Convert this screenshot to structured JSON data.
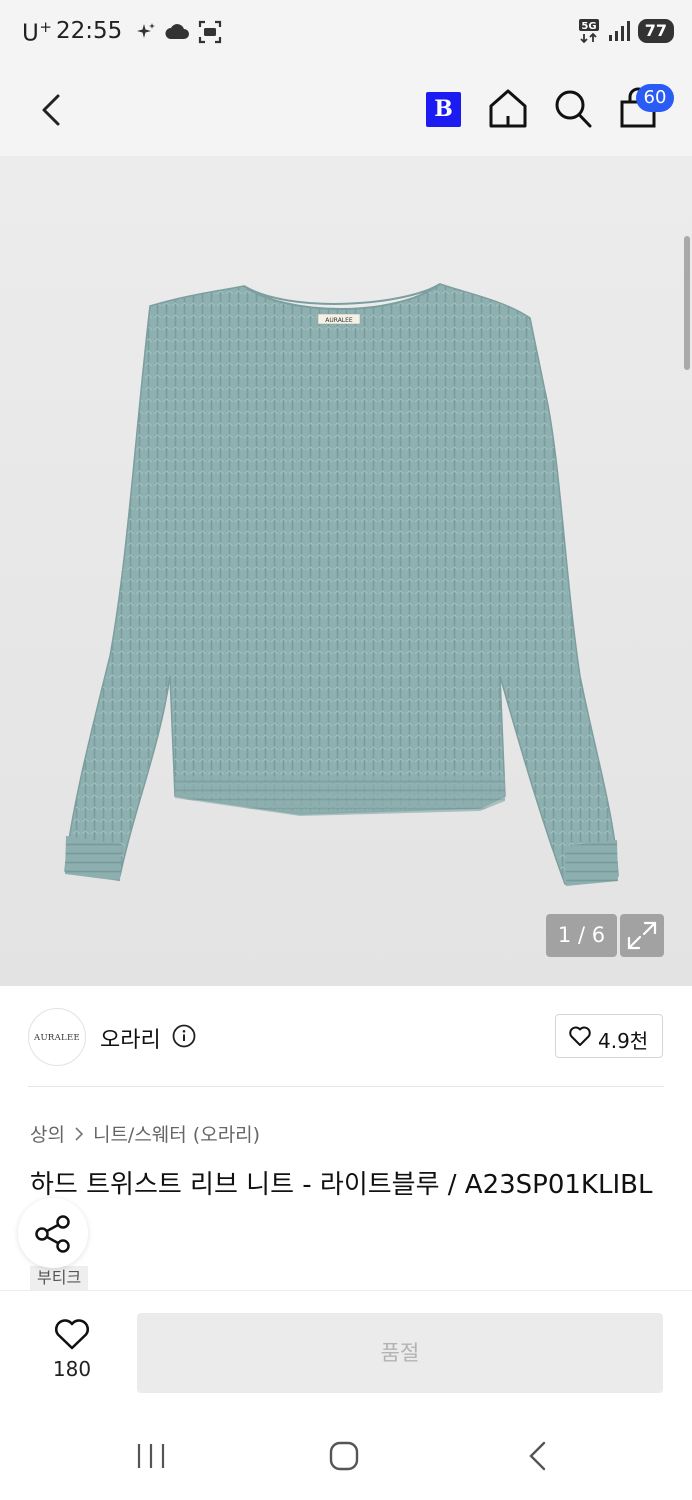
{
  "status_bar": {
    "carrier": "U",
    "carrier_sup": "+",
    "time": "22:55",
    "network": "5G",
    "battery": "77"
  },
  "nav": {
    "brand_logo_letter": "B",
    "cart_count": "60"
  },
  "gallery": {
    "counter": "1 / 6",
    "label_text": "AURALEE",
    "sweater_color": "#8fb0b0"
  },
  "brand": {
    "logo_text": "AURALEE",
    "name": "오라리",
    "likes": "4.9천"
  },
  "breadcrumb": {
    "items": [
      "상의",
      "니트/스웨터 (오라리)"
    ]
  },
  "product": {
    "title": "하드 트위스트 리브 니트 - 라이트블루 / A23SP01KLIBL",
    "tag": "부티크"
  },
  "action_bar": {
    "wish_count": "180",
    "soldout_label": "품절"
  },
  "icons": {
    "back": "chevron-left-icon",
    "home": "home-icon",
    "search": "search-icon",
    "cart": "shopping-bag-icon",
    "expand": "expand-icon",
    "info": "info-icon",
    "heart": "heart-icon",
    "share": "share-icon"
  },
  "colors": {
    "accent": "#2a5bf5",
    "b_logo": "#1b1bf2"
  }
}
